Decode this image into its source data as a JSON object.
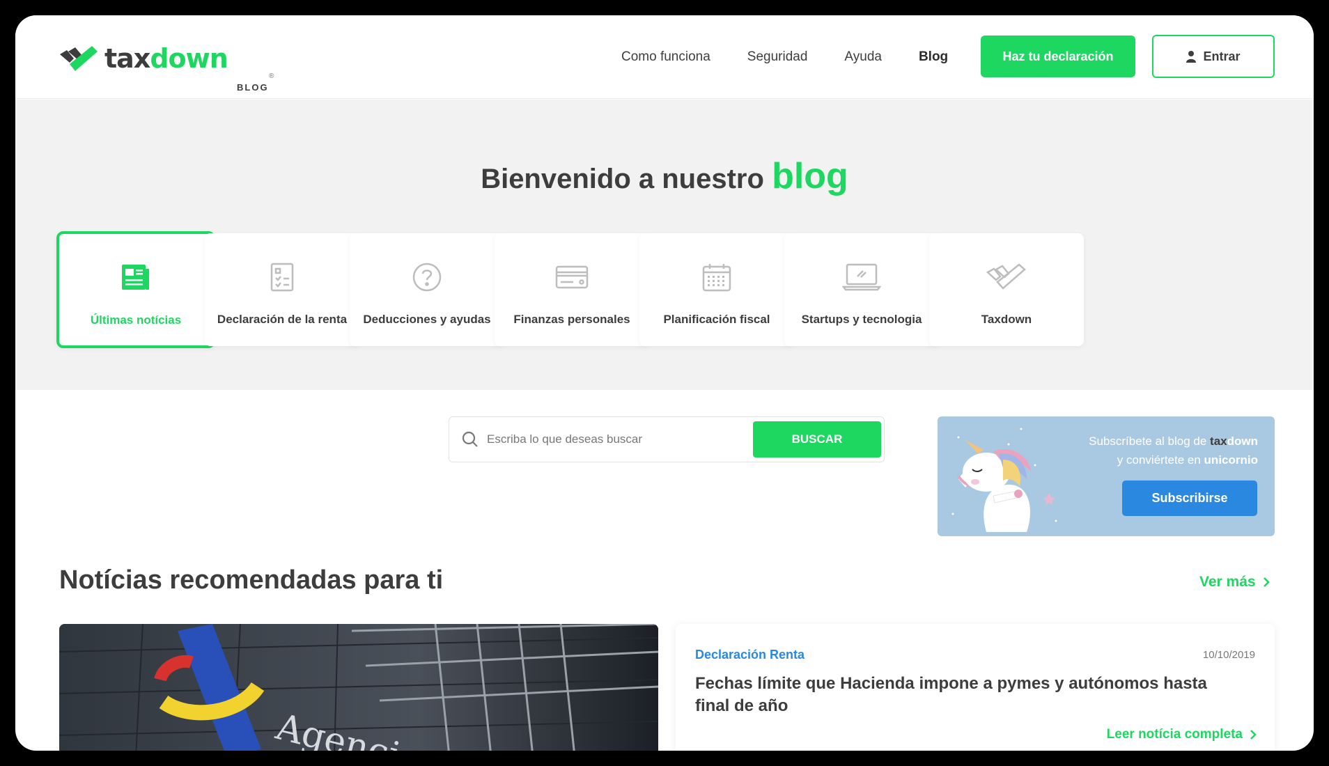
{
  "header": {
    "logo": {
      "part1": "tax",
      "part2": "down",
      "sub": "BLOG",
      "reg": "®"
    },
    "nav": [
      {
        "label": "Como funciona"
      },
      {
        "label": "Seguridad"
      },
      {
        "label": "Ayuda"
      },
      {
        "label": "Blog"
      }
    ],
    "cta_label": "Haz tu declaración",
    "login_label": "Entrar"
  },
  "hero": {
    "title_prefix": "Bienvenido a nuestro",
    "title_accent": "blog"
  },
  "categories": [
    {
      "label": "Últimas notícias",
      "icon": "newspaper-icon",
      "active": true
    },
    {
      "label": "Declaración de la renta",
      "icon": "checklist-icon"
    },
    {
      "label": "Deducciones y ayudas",
      "icon": "question-icon"
    },
    {
      "label": "Finanzas personales",
      "icon": "credit-card-icon"
    },
    {
      "label": "Planificación fiscal",
      "icon": "calendar-icon"
    },
    {
      "label": "Startups y tecnologia",
      "icon": "laptop-icon"
    },
    {
      "label": "Taxdown",
      "icon": "taxdown-logo-icon"
    }
  ],
  "search": {
    "placeholder": "Escriba lo que deseas buscar",
    "button_label": "BUSCAR"
  },
  "promo": {
    "line1_prefix": "Subscríbete al blog de",
    "brand_part1": "tax",
    "brand_part2": "down",
    "line2_prefix": "y conviértete en",
    "line2_bold": "unicornio",
    "button_label": "Subscribirse"
  },
  "recommended": {
    "title": "Notícias recomendadas para ti",
    "see_more": "Ver más",
    "photo_sign_text": "Agencia T",
    "news": {
      "category": "Declaración Renta",
      "date": "10/10/2019",
      "title": "Fechas límite que Hacienda impone a pymes y autónomos hasta final de año",
      "link": "Leer notícia completa"
    }
  },
  "colors": {
    "brand_green": "#1ed760",
    "dark_text": "#3d3d3d",
    "accent_blue": "#2b88e0",
    "promo_bg": "#a9c9e2"
  }
}
